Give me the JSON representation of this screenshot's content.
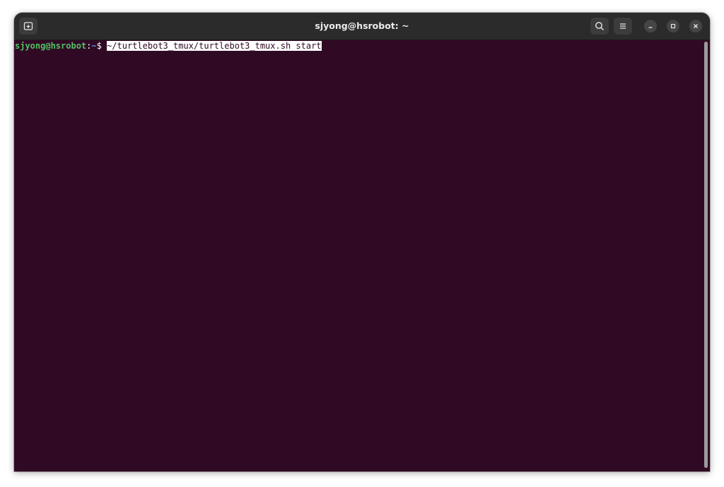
{
  "window": {
    "title": "sjyong@hsrobot: ~"
  },
  "titlebar": {
    "new_tab_icon": "new-tab-icon",
    "search_icon": "search-icon",
    "menu_icon": "hamburger-menu-icon",
    "minimize_icon": "minimize-icon",
    "maximize_icon": "maximize-icon",
    "close_icon": "close-icon"
  },
  "terminal": {
    "prompt_user_host": "sjyong@hsrobot",
    "prompt_colon": ":",
    "prompt_cwd": "~",
    "prompt_symbol": "$ ",
    "command": "~/turtlebot3_tmux/turtlebot3_tmux.sh start",
    "colors": {
      "background": "#300a24",
      "user_host": "#4fc263",
      "cwd": "#5f8fd7",
      "text": "#ffffff"
    }
  },
  "scrollbar": {
    "position_fraction": 0.0,
    "visible_fraction": 1.0
  }
}
